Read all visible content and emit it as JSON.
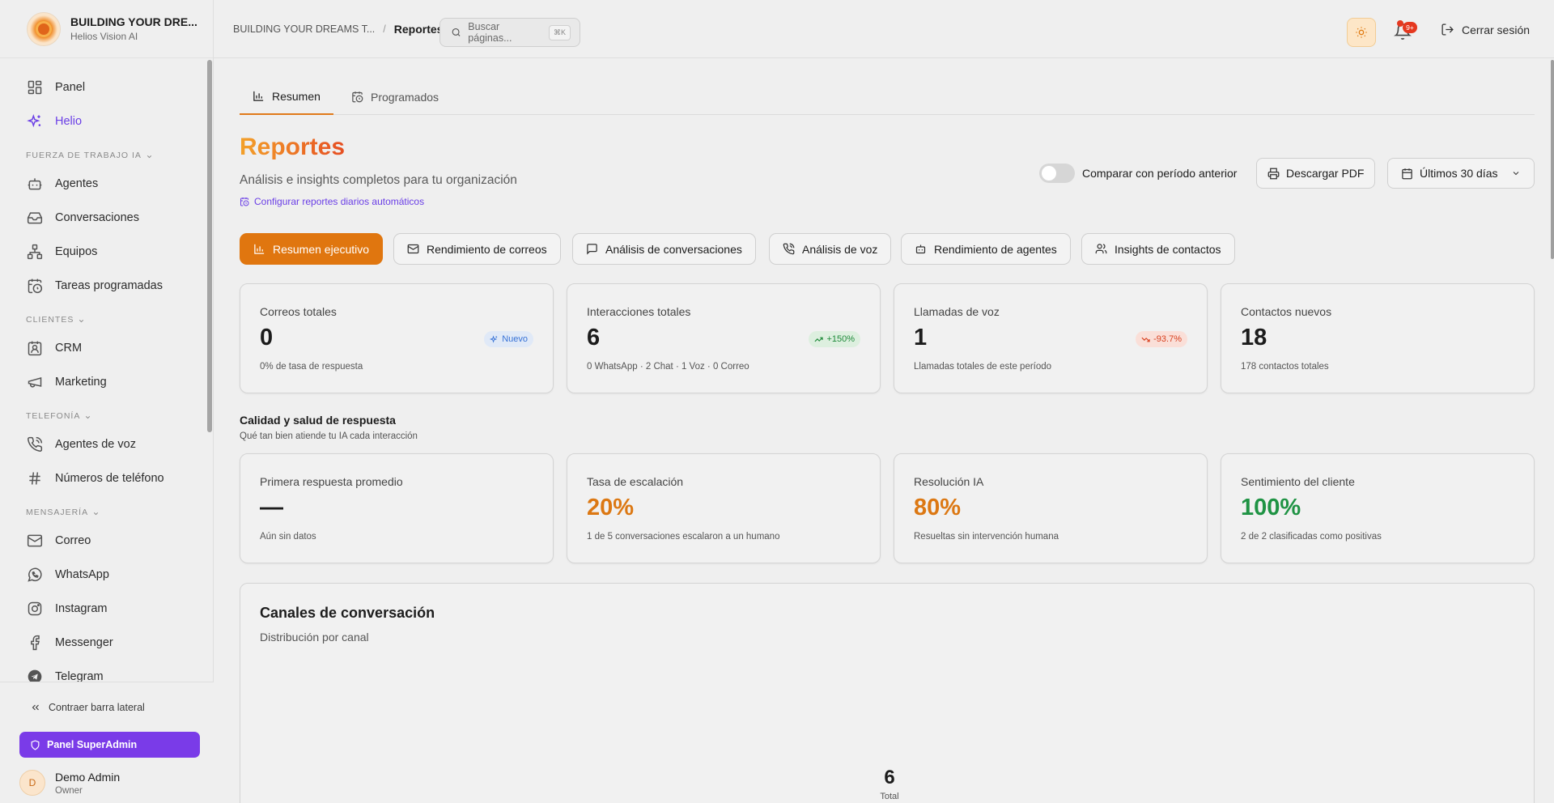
{
  "brand": {
    "name": "BUILDING YOUR DRE...",
    "subtitle": "Helios Vision AI"
  },
  "sidebar": {
    "top_items": [
      {
        "label": "Panel",
        "icon": "dashboard-icon"
      },
      {
        "label": "Helio",
        "icon": "sparkles-icon",
        "active": true
      }
    ],
    "sections": [
      {
        "title": "FUERZA DE TRABAJO IA",
        "items": [
          {
            "label": "Agentes",
            "icon": "bot-icon"
          },
          {
            "label": "Conversaciones",
            "icon": "inbox-icon"
          },
          {
            "label": "Equipos",
            "icon": "network-icon"
          },
          {
            "label": "Tareas programadas",
            "icon": "calendar-clock-icon"
          }
        ]
      },
      {
        "title": "CLIENTES",
        "items": [
          {
            "label": "CRM",
            "icon": "contact-icon"
          },
          {
            "label": "Marketing",
            "icon": "megaphone-icon"
          }
        ]
      },
      {
        "title": "TELEFONÍA",
        "items": [
          {
            "label": "Agentes de voz",
            "icon": "phone-call-icon"
          },
          {
            "label": "Números de teléfono",
            "icon": "hash-icon"
          }
        ]
      },
      {
        "title": "MENSAJERÍA",
        "items": [
          {
            "label": "Correo",
            "icon": "mail-icon"
          },
          {
            "label": "WhatsApp",
            "icon": "whatsapp-icon"
          },
          {
            "label": "Instagram",
            "icon": "instagram-icon"
          },
          {
            "label": "Messenger",
            "icon": "facebook-icon"
          },
          {
            "label": "Telegram",
            "icon": "telegram-icon"
          }
        ]
      }
    ],
    "collapse_label": "Contraer barra lateral",
    "superadmin_label": "Panel SuperAdmin",
    "user": {
      "initial": "D",
      "name": "Demo Admin",
      "role": "Owner"
    }
  },
  "topbar": {
    "breadcrumb_parent": "BUILDING YOUR DREAMS T...",
    "breadcrumb_separator": "/",
    "breadcrumb_current": "Reportes",
    "search_placeholder": "Buscar páginas...",
    "search_shortcut": "⌘K",
    "notification_count": "9+",
    "logout_label": "Cerrar sesión"
  },
  "tabs": [
    {
      "label": "Resumen",
      "active": true
    },
    {
      "label": "Programados",
      "active": false
    }
  ],
  "header": {
    "title": "Reportes",
    "subtitle": "Análisis e insights completos para tu organización",
    "config_link": "Configurar reportes diarios automáticos",
    "compare_label": "Comparar con período anterior",
    "compare_enabled": false,
    "download_label": "Descargar PDF",
    "range_label": "Últimos 30 días"
  },
  "report_tabs": [
    {
      "label": "Resumen ejecutivo",
      "active": true
    },
    {
      "label": "Rendimiento de correos"
    },
    {
      "label": "Análisis de conversaciones"
    },
    {
      "label": "Análisis de voz"
    },
    {
      "label": "Rendimiento de agentes"
    },
    {
      "label": "Insights de contactos"
    }
  ],
  "kpis": [
    {
      "label": "Correos totales",
      "value": "0",
      "badge": "Nuevo",
      "note": "0% de tasa de respuesta"
    },
    {
      "label": "Interacciones totales",
      "value": "6",
      "badge": "+150%",
      "note": "0 WhatsApp · 2 Chat · 1 Voz · 0 Correo"
    },
    {
      "label": "Llamadas de voz",
      "value": "1",
      "badge": "-93.7%",
      "note": "Llamadas totales de este período"
    },
    {
      "label": "Contactos nuevos",
      "value": "18",
      "note": "178 contactos totales"
    }
  ],
  "quality": {
    "title": "Calidad y salud de respuesta",
    "subtitle": "Qué tan bien atiende tu IA cada interacción",
    "cards": [
      {
        "label": "Primera respuesta promedio",
        "value": "—",
        "note": "Aún sin datos"
      },
      {
        "label": "Tasa de escalación",
        "value": "20%",
        "note": "1 de 5 conversaciones escalaron a un humano"
      },
      {
        "label": "Resolución IA",
        "value": "80%",
        "note": "Resueltas sin intervención humana"
      },
      {
        "label": "Sentimiento del cliente",
        "value": "100%",
        "note": "2 de 2 clasificadas como positivas"
      }
    ]
  },
  "channels": {
    "title": "Canales de conversación",
    "subtitle": "Distribución por canal",
    "total_value": "6",
    "total_label": "Total"
  },
  "colors": {
    "accent_orange": "#e0760f",
    "accent_purple": "#7a3be8",
    "positive_green": "#1f9344",
    "negative_red": "#d8401f"
  }
}
